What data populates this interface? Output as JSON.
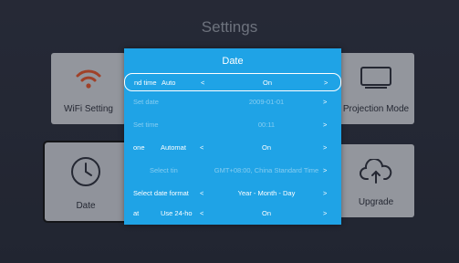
{
  "screen": {
    "title": "Settings"
  },
  "tiles": {
    "wifi": {
      "label": "WiFi Setting",
      "icon": "wifi-icon"
    },
    "projection": {
      "label": "Projection Mode",
      "icon": "monitor-icon"
    },
    "date": {
      "label": "Date",
      "icon": "clock-icon"
    },
    "upgrade": {
      "label": "Upgrade",
      "icon": "cloud-upload-icon"
    }
  },
  "dialog": {
    "title": "Date",
    "accent_color": "#1fa3e6",
    "rows": [
      {
        "label": "nd time",
        "sublabel": "Auto",
        "value": "On",
        "enabled": true,
        "selected": true
      },
      {
        "label": "Set date",
        "sublabel": "",
        "value": "2009-01-01",
        "enabled": false,
        "selected": false
      },
      {
        "label": "Set time",
        "sublabel": "",
        "value": "00:11",
        "enabled": false,
        "selected": false
      },
      {
        "label": "one",
        "sublabel": "Automat",
        "value": "On",
        "enabled": true,
        "selected": false
      },
      {
        "label": "",
        "sublabel": "Select tin",
        "value": "GMT+08:00, China Standard Time",
        "enabled": false,
        "selected": false
      },
      {
        "label": "Select date format",
        "sublabel": "",
        "value": "Year - Month - Day",
        "enabled": true,
        "selected": false
      },
      {
        "label": "at",
        "sublabel": "Use 24-ho",
        "value": "On",
        "enabled": true,
        "selected": false
      }
    ],
    "arrow_left": "<",
    "arrow_right": ">"
  }
}
